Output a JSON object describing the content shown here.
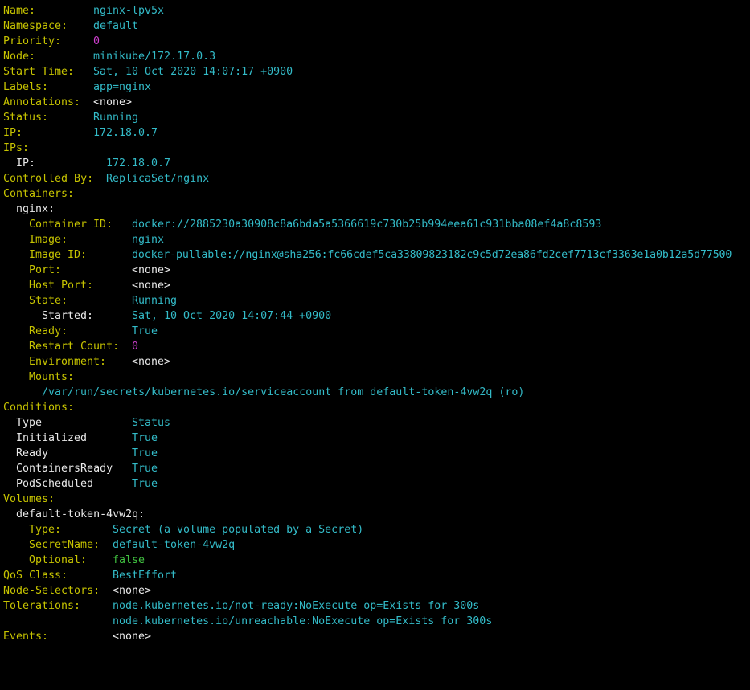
{
  "terminal": {
    "colors": {
      "background": "#000000",
      "key_yellow": "#c7c400",
      "key_white": "#e8e8e8",
      "value_cyan": "#33bbc8",
      "number_magenta": "#d040d0",
      "bool_green": "#40c040"
    },
    "name": {
      "key": "Name:",
      "value": "nginx-lpv5x"
    },
    "namespace": {
      "key": "Namespace:",
      "value": "default"
    },
    "priority": {
      "key": "Priority:",
      "value": "0"
    },
    "node": {
      "key": "Node:",
      "value": "minikube/172.17.0.3"
    },
    "start_time": {
      "key": "Start Time:",
      "value": "Sat, 10 Oct 2020 14:07:17 +0900"
    },
    "labels": {
      "key": "Labels:",
      "value": "app=nginx"
    },
    "annotations": {
      "key": "Annotations:",
      "value": "<none>"
    },
    "status": {
      "key": "Status:",
      "value": "Running"
    },
    "ip": {
      "key": "IP:",
      "value": "172.18.0.7"
    },
    "ips": {
      "key": "IPs:",
      "ip_key": "IP:",
      "ip_value": "172.18.0.7"
    },
    "controlled_by": {
      "key": "Controlled By:",
      "value": "ReplicaSet/nginx"
    },
    "containers": {
      "key": "Containers:",
      "name": "nginx:",
      "container_id": {
        "key": "Container ID:",
        "value": "docker://2885230a30908c8a6bda5a5366619c730b25b994eea61c931bba08ef4a8c8593"
      },
      "image": {
        "key": "Image:",
        "value": "nginx"
      },
      "image_id": {
        "key": "Image ID:",
        "value": "docker-pullable://nginx@sha256:fc66cdef5ca33809823182c9c5d72ea86fd2cef7713cf3363e1a0b12a5d77500"
      },
      "port": {
        "key": "Port:",
        "value": "<none>"
      },
      "host_port": {
        "key": "Host Port:",
        "value": "<none>"
      },
      "state": {
        "key": "State:",
        "value": "Running"
      },
      "started": {
        "key": "Started:",
        "value": "Sat, 10 Oct 2020 14:07:44 +0900"
      },
      "ready": {
        "key": "Ready:",
        "value": "True"
      },
      "restart_count": {
        "key": "Restart Count:",
        "value": "0"
      },
      "environment": {
        "key": "Environment:",
        "value": "<none>"
      },
      "mounts": {
        "key": "Mounts:",
        "value": "/var/run/secrets/kubernetes.io/serviceaccount from default-token-4vw2q (ro)"
      }
    },
    "conditions": {
      "key": "Conditions:",
      "header": {
        "type": "Type",
        "status": "Status"
      },
      "rows": [
        {
          "type": "Initialized",
          "status": "True"
        },
        {
          "type": "Ready",
          "status": "True"
        },
        {
          "type": "ContainersReady",
          "status": "True"
        },
        {
          "type": "PodScheduled",
          "status": "True"
        }
      ]
    },
    "volumes": {
      "key": "Volumes:",
      "name": "default-token-4vw2q:",
      "type": {
        "key": "Type:",
        "value": "Secret (a volume populated by a Secret)"
      },
      "secret_name": {
        "key": "SecretName:",
        "value": "default-token-4vw2q"
      },
      "optional": {
        "key": "Optional:",
        "value": "false"
      }
    },
    "qos_class": {
      "key": "QoS Class:",
      "value": "BestEffort"
    },
    "node_selectors": {
      "key": "Node-Selectors:",
      "value": "<none>"
    },
    "tolerations": {
      "key": "Tolerations:",
      "values": [
        "node.kubernetes.io/not-ready:NoExecute op=Exists for 300s",
        "node.kubernetes.io/unreachable:NoExecute op=Exists for 300s"
      ]
    },
    "events": {
      "key": "Events:",
      "value": "<none>"
    }
  }
}
